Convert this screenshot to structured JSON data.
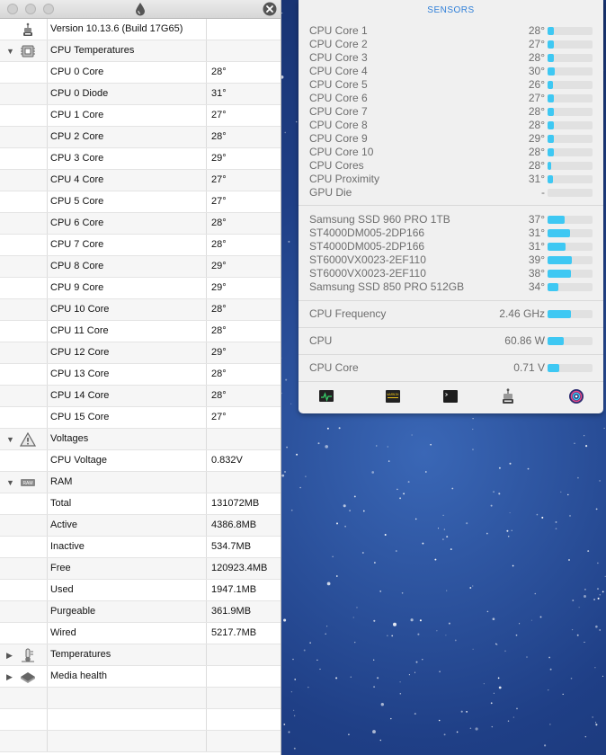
{
  "window": {
    "version_label": "Version 10.13.6 (Build 17G65)"
  },
  "tree": [
    {
      "type": "top",
      "icon": "hardware-monitor-icon",
      "label": "Version 10.13.6 (Build 17G65)",
      "value": ""
    },
    {
      "type": "group",
      "expanded": true,
      "icon": "cpu-chip-icon",
      "label": "CPU Temperatures",
      "value": ""
    },
    {
      "type": "item",
      "label": "CPU 0 Core",
      "value": "28°"
    },
    {
      "type": "item",
      "label": "CPU 0 Diode",
      "value": "31°"
    },
    {
      "type": "item",
      "label": "CPU 1 Core",
      "value": "27°"
    },
    {
      "type": "item",
      "label": "CPU 2 Core",
      "value": "28°"
    },
    {
      "type": "item",
      "label": "CPU 3 Core",
      "value": "29°"
    },
    {
      "type": "item",
      "label": "CPU 4 Core",
      "value": "27°"
    },
    {
      "type": "item",
      "label": "CPU 5 Core",
      "value": "27°"
    },
    {
      "type": "item",
      "label": "CPU 6 Core",
      "value": "28°"
    },
    {
      "type": "item",
      "label": "CPU 7 Core",
      "value": "28°"
    },
    {
      "type": "item",
      "label": "CPU 8 Core",
      "value": "29°"
    },
    {
      "type": "item",
      "label": "CPU 9 Core",
      "value": "29°"
    },
    {
      "type": "item",
      "label": "CPU 10 Core",
      "value": "28°"
    },
    {
      "type": "item",
      "label": "CPU 11 Core",
      "value": "28°"
    },
    {
      "type": "item",
      "label": "CPU 12 Core",
      "value": "29°"
    },
    {
      "type": "item",
      "label": "CPU 13 Core",
      "value": "28°"
    },
    {
      "type": "item",
      "label": "CPU 14 Core",
      "value": "28°"
    },
    {
      "type": "item",
      "label": "CPU 15 Core",
      "value": "27°"
    },
    {
      "type": "group",
      "expanded": true,
      "icon": "warning-triangle-icon",
      "label": "Voltages",
      "value": ""
    },
    {
      "type": "item",
      "label": "CPU Voltage",
      "value": "0.832V"
    },
    {
      "type": "group",
      "expanded": true,
      "icon": "ram-chip-icon",
      "icon_text": "RAM",
      "label": "RAM",
      "value": ""
    },
    {
      "type": "item",
      "label": "Total",
      "value": "131072MB"
    },
    {
      "type": "item",
      "label": "Active",
      "value": "4386.8MB"
    },
    {
      "type": "item",
      "label": "Inactive",
      "value": "534.7MB"
    },
    {
      "type": "item",
      "label": "Free",
      "value": "120923.4MB"
    },
    {
      "type": "item",
      "label": "Used",
      "value": "1947.1MB"
    },
    {
      "type": "item",
      "label": "Purgeable",
      "value": "361.9MB"
    },
    {
      "type": "item",
      "label": "Wired",
      "value": "5217.7MB"
    },
    {
      "type": "group",
      "expanded": false,
      "icon": "thermometer-icon",
      "label": "Temperatures",
      "value": ""
    },
    {
      "type": "group",
      "expanded": false,
      "icon": "disk-icon",
      "label": "Media health",
      "value": ""
    },
    {
      "type": "empty",
      "label": "",
      "value": ""
    },
    {
      "type": "empty",
      "label": "",
      "value": ""
    },
    {
      "type": "empty",
      "label": "",
      "value": ""
    }
  ],
  "sensors": {
    "title": "SENSORS",
    "accent": "#3ec8f3",
    "cpu": [
      {
        "label": "CPU Core 1",
        "value": "28°",
        "level": 0.14
      },
      {
        "label": "CPU Core 2",
        "value": "27°",
        "level": 0.13
      },
      {
        "label": "CPU Core 3",
        "value": "28°",
        "level": 0.14
      },
      {
        "label": "CPU Core 4",
        "value": "30°",
        "level": 0.15
      },
      {
        "label": "CPU Core 5",
        "value": "26°",
        "level": 0.12
      },
      {
        "label": "CPU Core 6",
        "value": "27°",
        "level": 0.13
      },
      {
        "label": "CPU Core 7",
        "value": "28°",
        "level": 0.14
      },
      {
        "label": "CPU Core 8",
        "value": "28°",
        "level": 0.14
      },
      {
        "label": "CPU Core 9",
        "value": "29°",
        "level": 0.14
      },
      {
        "label": "CPU Core 10",
        "value": "28°",
        "level": 0.14
      },
      {
        "label": "CPU Cores",
        "value": "28°",
        "level": 0.08
      },
      {
        "label": "CPU Proximity",
        "value": "31°",
        "level": 0.12
      },
      {
        "label": "GPU Die",
        "value": "-",
        "level": 0
      }
    ],
    "disks": [
      {
        "label": " Samsung SSD 960 PRO 1TB",
        "value": "37°",
        "level": 0.38
      },
      {
        "label": "ST4000DM005-2DP166",
        "value": "31°",
        "level": 0.5
      },
      {
        "label": "ST4000DM005-2DP166",
        "value": "31°",
        "level": 0.4
      },
      {
        "label": "ST6000VX0023-2EF110",
        "value": "39°",
        "level": 0.54
      },
      {
        "label": "ST6000VX0023-2EF110",
        "value": "38°",
        "level": 0.52
      },
      {
        "label": "Samsung SSD 850 PRO 512GB",
        "value": "34°",
        "level": 0.24
      }
    ],
    "stats": [
      {
        "label": "CPU Frequency",
        "value": "2.46 GHz",
        "level": 0.52
      },
      {
        "label": "CPU",
        "value": "60.86 W",
        "level": 0.36
      },
      {
        "label": "CPU Core",
        "value": "0.71 V",
        "level": 0.26
      }
    ],
    "toolbar": [
      "activity-monitor-icon",
      "console-warning-icon",
      "terminal-icon",
      "hardware-monitor-icon",
      "disk-utility-icon"
    ],
    "console_icon_text": "WARNIN"
  }
}
